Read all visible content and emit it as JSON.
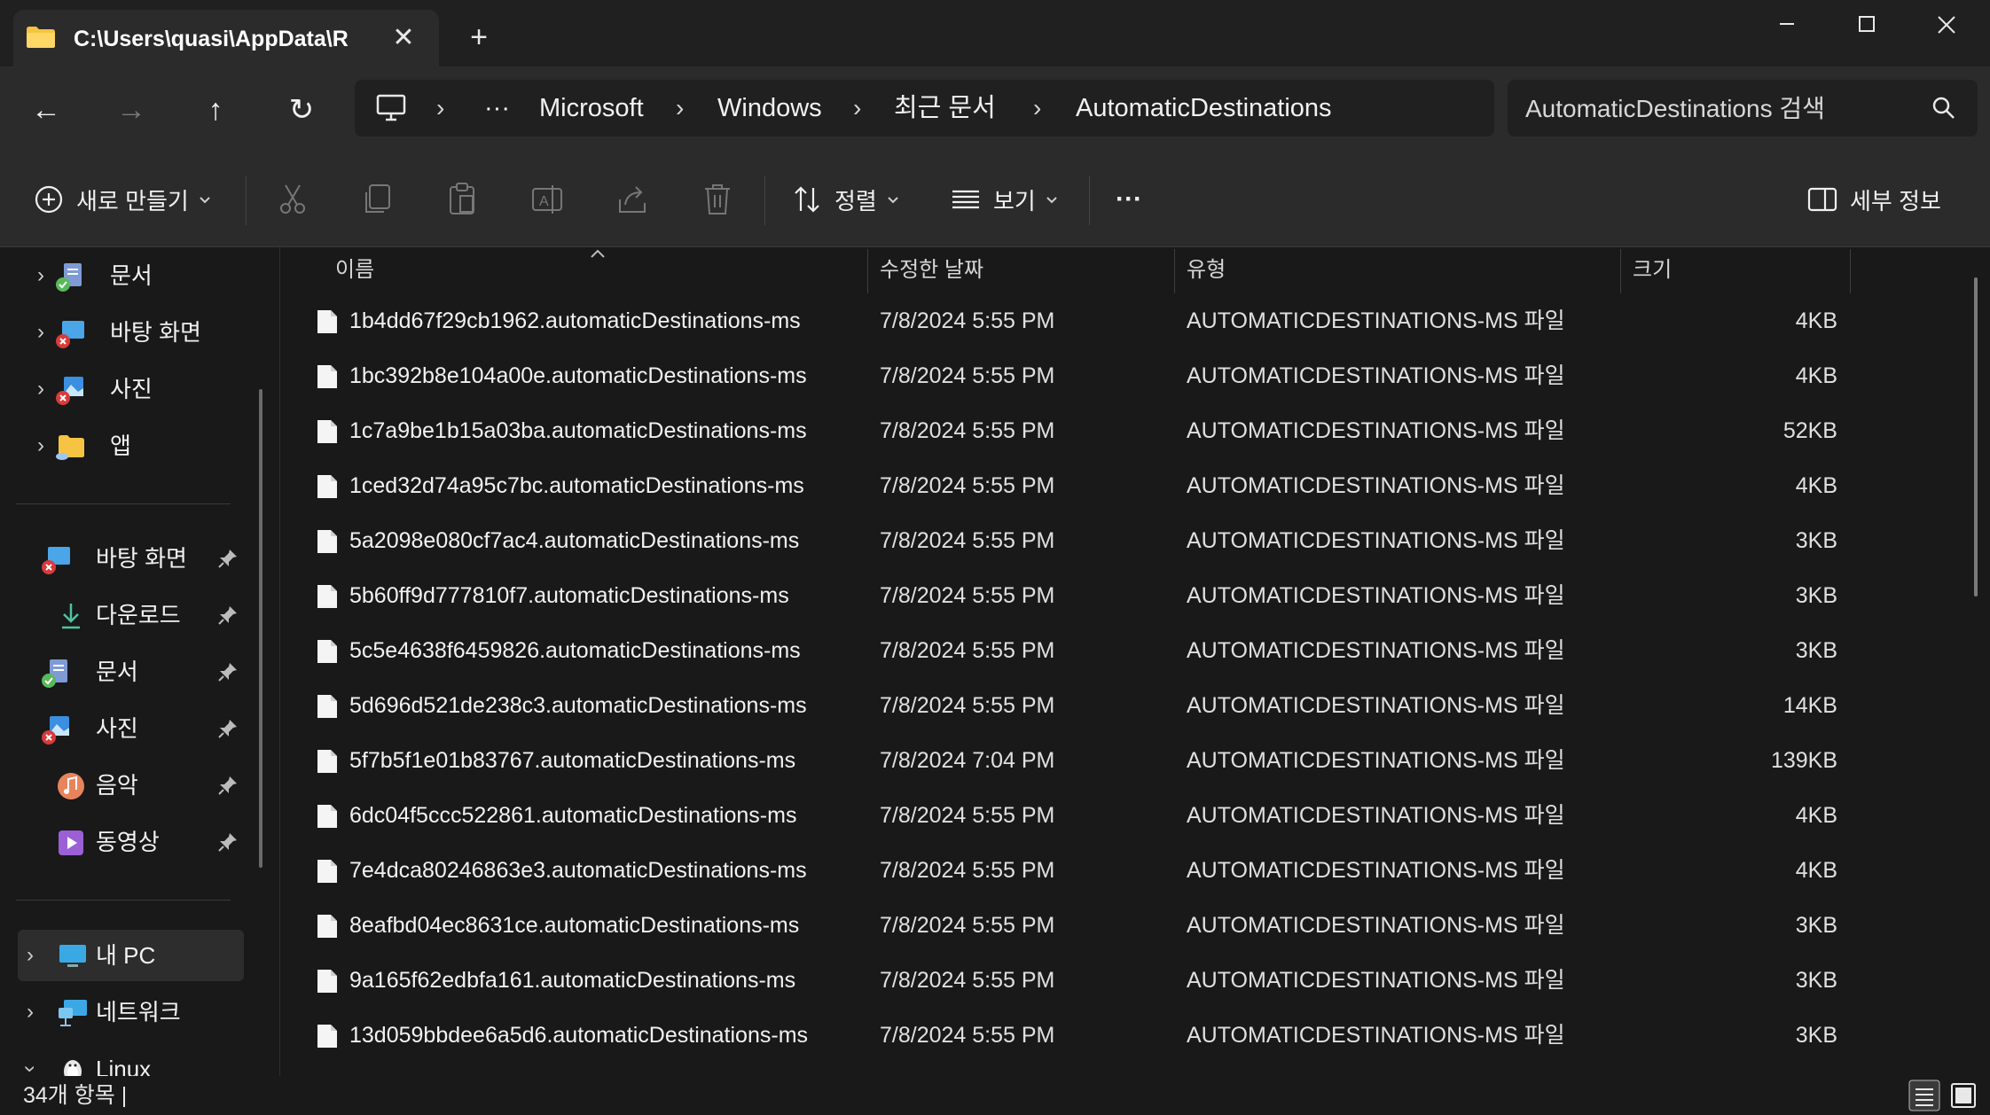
{
  "tab": {
    "title": "C:\\Users\\quasi\\AppData\\R",
    "close": "✕",
    "new_tab": "+"
  },
  "window": {
    "minimize": "—",
    "maximize": "☐",
    "close": "✕"
  },
  "nav": {
    "back": "←",
    "forward": "→",
    "up": "↑",
    "refresh": "↻"
  },
  "breadcrumb": {
    "more": "···",
    "separator": "›",
    "items": [
      "Microsoft",
      "Windows",
      "최근 문서",
      "AutomaticDestinations"
    ]
  },
  "search": {
    "placeholder": "AutomaticDestinations 검색"
  },
  "toolbar": {
    "new_label": "새로 만들기",
    "sort_label": "정렬",
    "view_label": "보기",
    "more_label": "···",
    "details_label": "세부 정보"
  },
  "sidebar": {
    "top_items": [
      "문서",
      "바탕 화면",
      "사진",
      "앱"
    ],
    "quick_access": [
      "바탕 화면",
      "다운로드",
      "문서",
      "사진",
      "음악",
      "동영상"
    ],
    "this_pc": "내 PC",
    "network": "네트워크",
    "linux": "Linux"
  },
  "columns": {
    "name": "이름",
    "date": "수정한 날짜",
    "type": "유형",
    "size": "크기"
  },
  "files": [
    {
      "name": "1b4dd67f29cb1962.automaticDestinations-ms",
      "date": "7/8/2024 5:55 PM",
      "type": "AUTOMATICDESTINATIONS-MS 파일",
      "size": "4KB"
    },
    {
      "name": "1bc392b8e104a00e.automaticDestinations-ms",
      "date": "7/8/2024 5:55 PM",
      "type": "AUTOMATICDESTINATIONS-MS 파일",
      "size": "4KB"
    },
    {
      "name": "1c7a9be1b15a03ba.automaticDestinations-ms",
      "date": "7/8/2024 5:55 PM",
      "type": "AUTOMATICDESTINATIONS-MS 파일",
      "size": "52KB"
    },
    {
      "name": "1ced32d74a95c7bc.automaticDestinations-ms",
      "date": "7/8/2024 5:55 PM",
      "type": "AUTOMATICDESTINATIONS-MS 파일",
      "size": "4KB"
    },
    {
      "name": "5a2098e080cf7ac4.automaticDestinations-ms",
      "date": "7/8/2024 5:55 PM",
      "type": "AUTOMATICDESTINATIONS-MS 파일",
      "size": "3KB"
    },
    {
      "name": "5b60ff9d777810f7.automaticDestinations-ms",
      "date": "7/8/2024 5:55 PM",
      "type": "AUTOMATICDESTINATIONS-MS 파일",
      "size": "3KB"
    },
    {
      "name": "5c5e4638f6459826.automaticDestinations-ms",
      "date": "7/8/2024 5:55 PM",
      "type": "AUTOMATICDESTINATIONS-MS 파일",
      "size": "3KB"
    },
    {
      "name": "5d696d521de238c3.automaticDestinations-ms",
      "date": "7/8/2024 5:55 PM",
      "type": "AUTOMATICDESTINATIONS-MS 파일",
      "size": "14KB"
    },
    {
      "name": "5f7b5f1e01b83767.automaticDestinations-ms",
      "date": "7/8/2024 7:04 PM",
      "type": "AUTOMATICDESTINATIONS-MS 파일",
      "size": "139KB"
    },
    {
      "name": "6dc04f5ccc522861.automaticDestinations-ms",
      "date": "7/8/2024 5:55 PM",
      "type": "AUTOMATICDESTINATIONS-MS 파일",
      "size": "4KB"
    },
    {
      "name": "7e4dca80246863e3.automaticDestinations-ms",
      "date": "7/8/2024 5:55 PM",
      "type": "AUTOMATICDESTINATIONS-MS 파일",
      "size": "4KB"
    },
    {
      "name": "8eafbd04ec8631ce.automaticDestinations-ms",
      "date": "7/8/2024 5:55 PM",
      "type": "AUTOMATICDESTINATIONS-MS 파일",
      "size": "3KB"
    },
    {
      "name": "9a165f62edbfa161.automaticDestinations-ms",
      "date": "7/8/2024 5:55 PM",
      "type": "AUTOMATICDESTINATIONS-MS 파일",
      "size": "3KB"
    },
    {
      "name": "13d059bbdee6a5d6.automaticDestinations-ms",
      "date": "7/8/2024 5:55 PM",
      "type": "AUTOMATICDESTINATIONS-MS 파일",
      "size": "3KB"
    }
  ],
  "status": {
    "item_count": "34개 항목  |"
  },
  "colors": {
    "accent": "#60cdff",
    "folder": "#f6c342",
    "background": "#191919",
    "chrome": "#2b2b2b"
  }
}
